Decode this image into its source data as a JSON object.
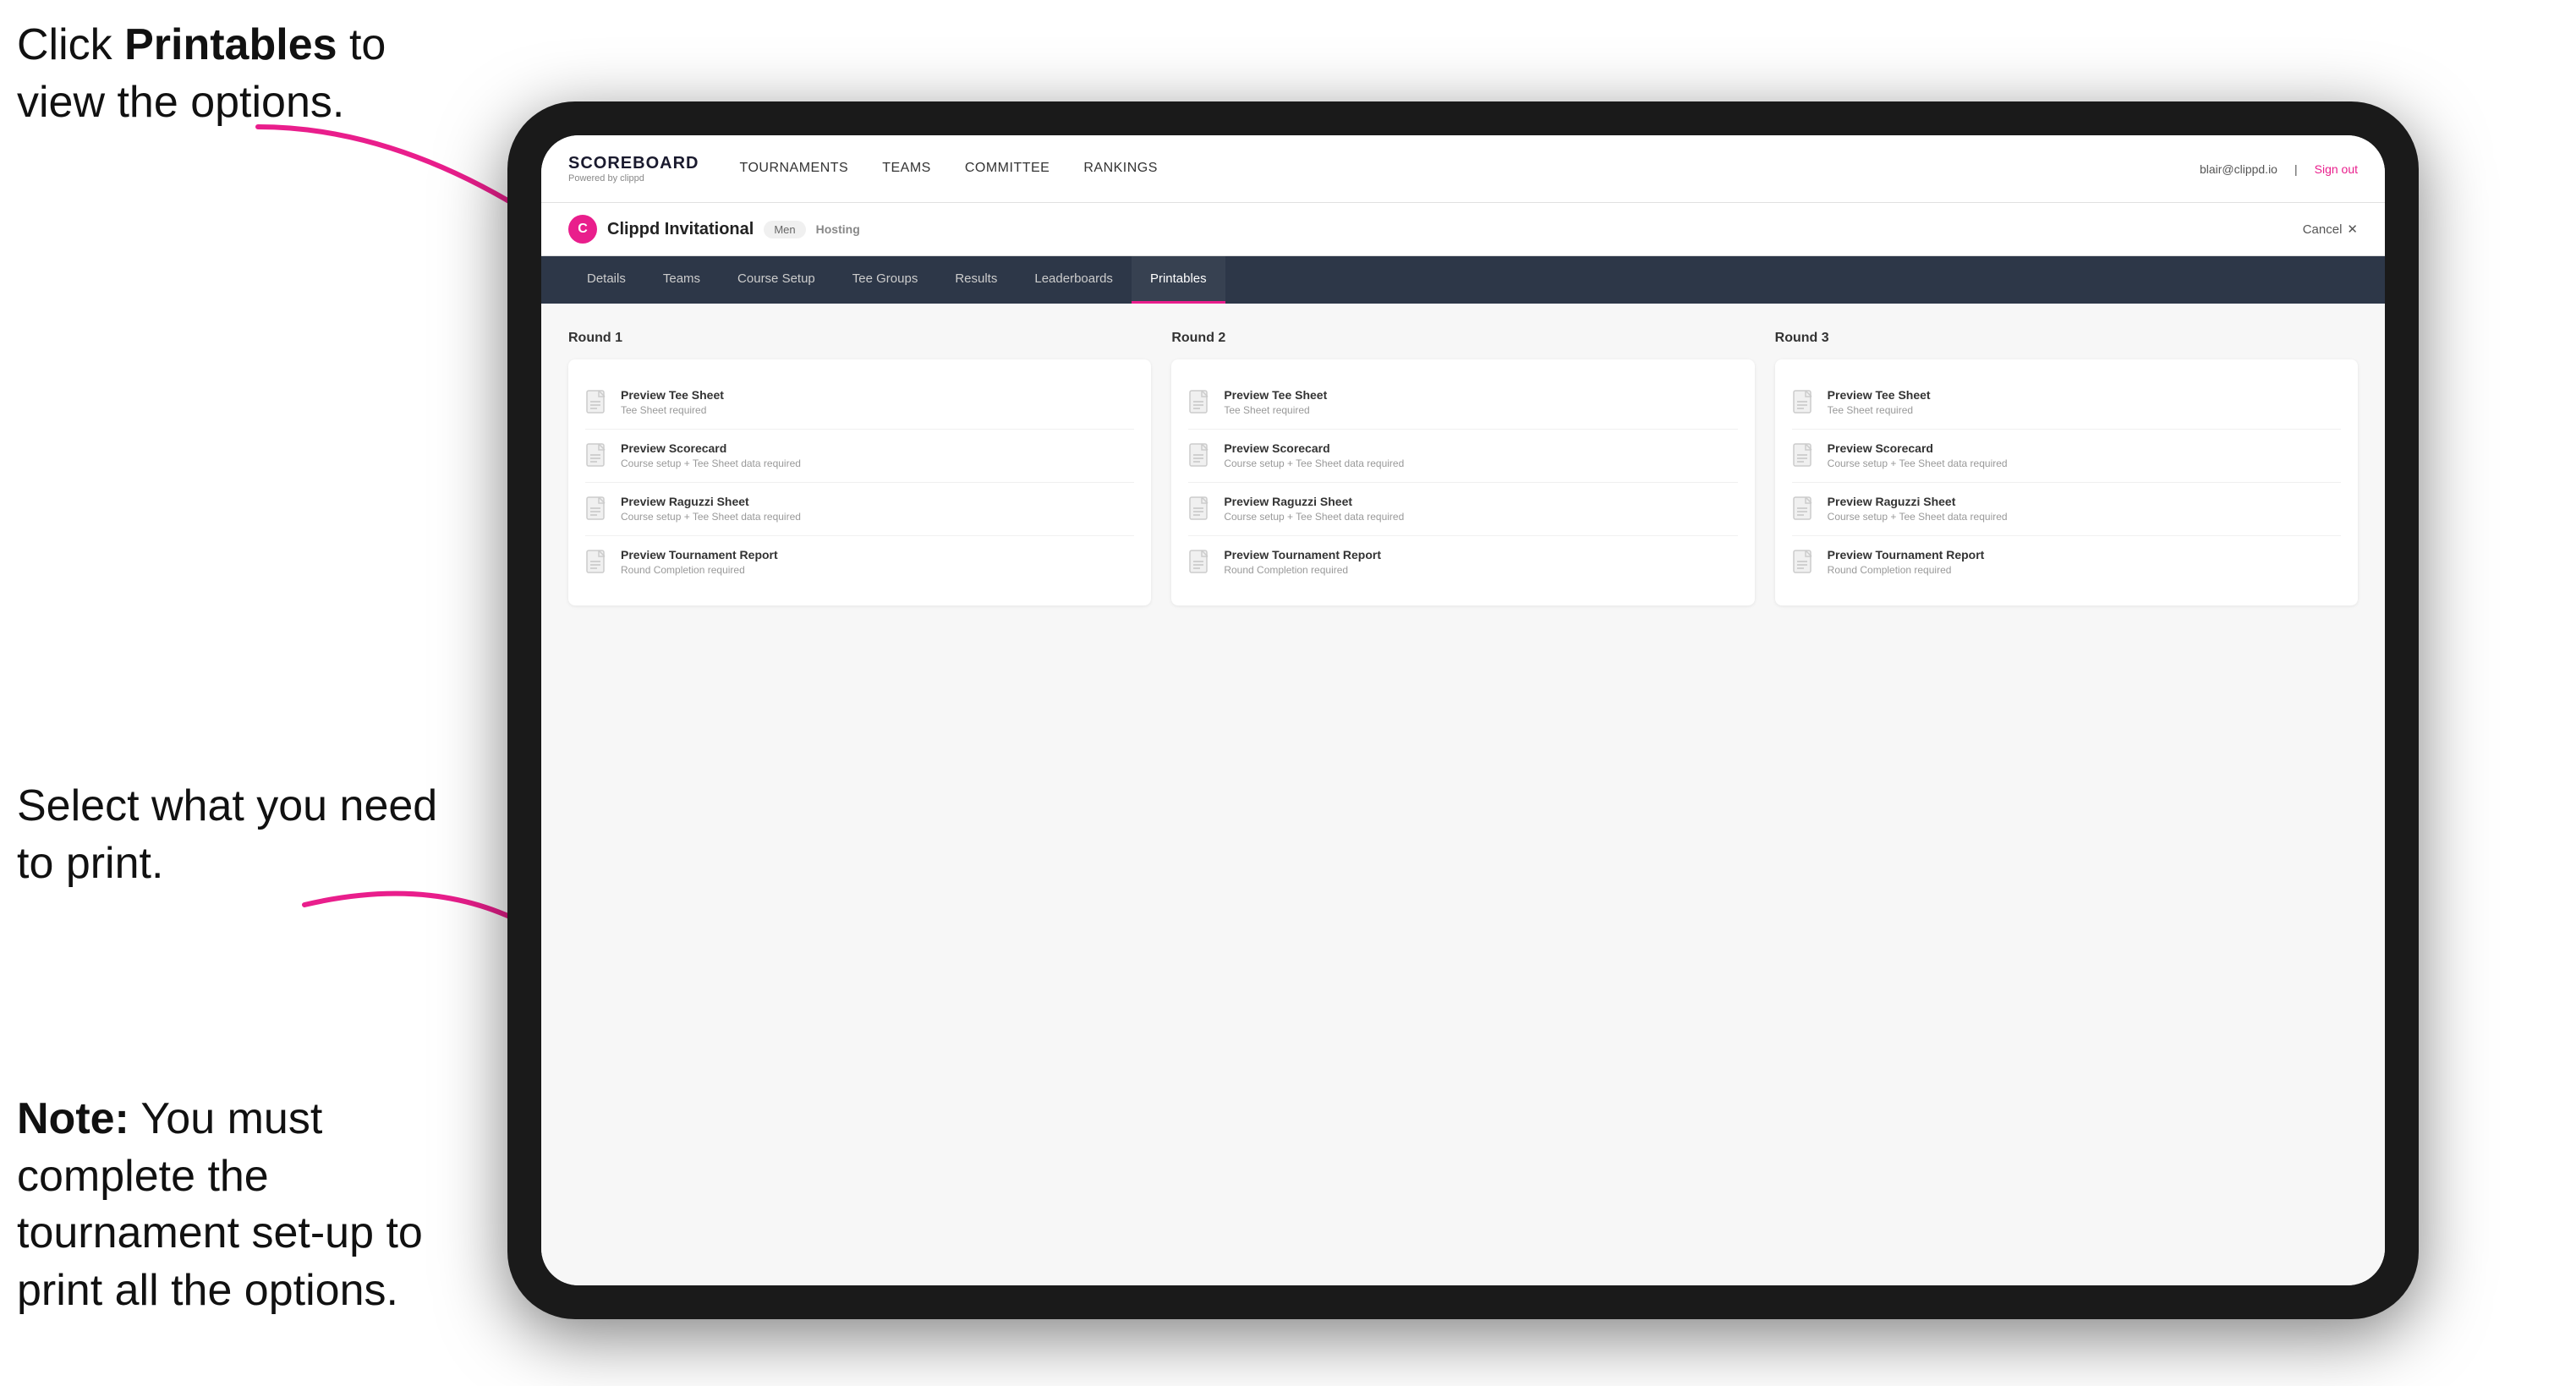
{
  "annotations": {
    "top": {
      "line1": "Click ",
      "bold": "Printables",
      "line2": " to",
      "line3": "view the options."
    },
    "middle": {
      "text": "Select what you need to print."
    },
    "bottom": {
      "bold": "Note:",
      "text": " You must complete the tournament set-up to print all the options."
    }
  },
  "topnav": {
    "logo_title": "SCOREBOARD",
    "logo_subtitle": "Powered by clippd",
    "links": [
      "TOURNAMENTS",
      "TEAMS",
      "COMMITTEE",
      "RANKINGS"
    ],
    "user": "blair@clippd.io",
    "sign_out": "Sign out"
  },
  "tournament": {
    "logo_letter": "C",
    "name": "Clippd Invitational",
    "badge": "Men",
    "status": "Hosting",
    "cancel": "Cancel"
  },
  "tabs": [
    {
      "label": "Details",
      "active": false
    },
    {
      "label": "Teams",
      "active": false
    },
    {
      "label": "Course Setup",
      "active": false
    },
    {
      "label": "Tee Groups",
      "active": false
    },
    {
      "label": "Results",
      "active": false
    },
    {
      "label": "Leaderboards",
      "active": false
    },
    {
      "label": "Printables",
      "active": true
    }
  ],
  "rounds": [
    {
      "header": "Round 1",
      "items": [
        {
          "title": "Preview Tee Sheet",
          "subtitle": "Tee Sheet required"
        },
        {
          "title": "Preview Scorecard",
          "subtitle": "Course setup + Tee Sheet data required"
        },
        {
          "title": "Preview Raguzzi Sheet",
          "subtitle": "Course setup + Tee Sheet data required"
        },
        {
          "title": "Preview Tournament Report",
          "subtitle": "Round Completion required"
        }
      ]
    },
    {
      "header": "Round 2",
      "items": [
        {
          "title": "Preview Tee Sheet",
          "subtitle": "Tee Sheet required"
        },
        {
          "title": "Preview Scorecard",
          "subtitle": "Course setup + Tee Sheet data required"
        },
        {
          "title": "Preview Raguzzi Sheet",
          "subtitle": "Course setup + Tee Sheet data required"
        },
        {
          "title": "Preview Tournament Report",
          "subtitle": "Round Completion required"
        }
      ]
    },
    {
      "header": "Round 3",
      "items": [
        {
          "title": "Preview Tee Sheet",
          "subtitle": "Tee Sheet required"
        },
        {
          "title": "Preview Scorecard",
          "subtitle": "Course setup + Tee Sheet data required"
        },
        {
          "title": "Preview Raguzzi Sheet",
          "subtitle": "Course setup + Tee Sheet data required"
        },
        {
          "title": "Preview Tournament Report",
          "subtitle": "Round Completion required"
        }
      ]
    }
  ]
}
